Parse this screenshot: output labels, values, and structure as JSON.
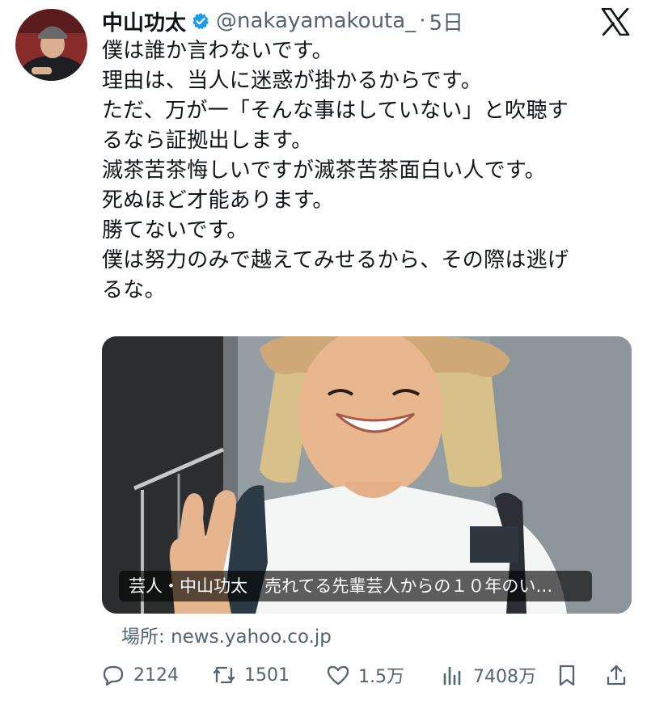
{
  "tweet": {
    "author_name": "中山功太",
    "handle": "@nakayamakouta_",
    "separator": "·",
    "time": "5日",
    "lines": [
      "僕は誰か言わないです。",
      "理由は、当人に迷惑が掛かるからです。",
      "ただ、万が一「そんな事はしていない」と吹聴す",
      "るなら証拠出します。",
      "滅茶苦茶悔しいですが滅茶苦茶面白い人です。",
      "死ぬほど才能あります。",
      "勝てないです。",
      "僕は努力のみで越えてみせるから、その際は逃げ",
      "るな。"
    ]
  },
  "card": {
    "caption": "芸人・中山功太　売れてる先輩芸人からの１０年のい…",
    "source_label": "場所:",
    "source_domain": "news.yahoo.co.jp"
  },
  "actions": {
    "replies": "2124",
    "reposts": "1501",
    "likes": "1.5万",
    "views": "7408万"
  },
  "icons": [
    "verified-badge-icon",
    "x-logo-icon",
    "reply-icon",
    "repost-icon",
    "like-icon",
    "views-icon",
    "bookmark-icon",
    "share-icon"
  ],
  "colors": {
    "text": "#0f1419",
    "muted": "#536471",
    "verified": "#1d9bf0"
  }
}
